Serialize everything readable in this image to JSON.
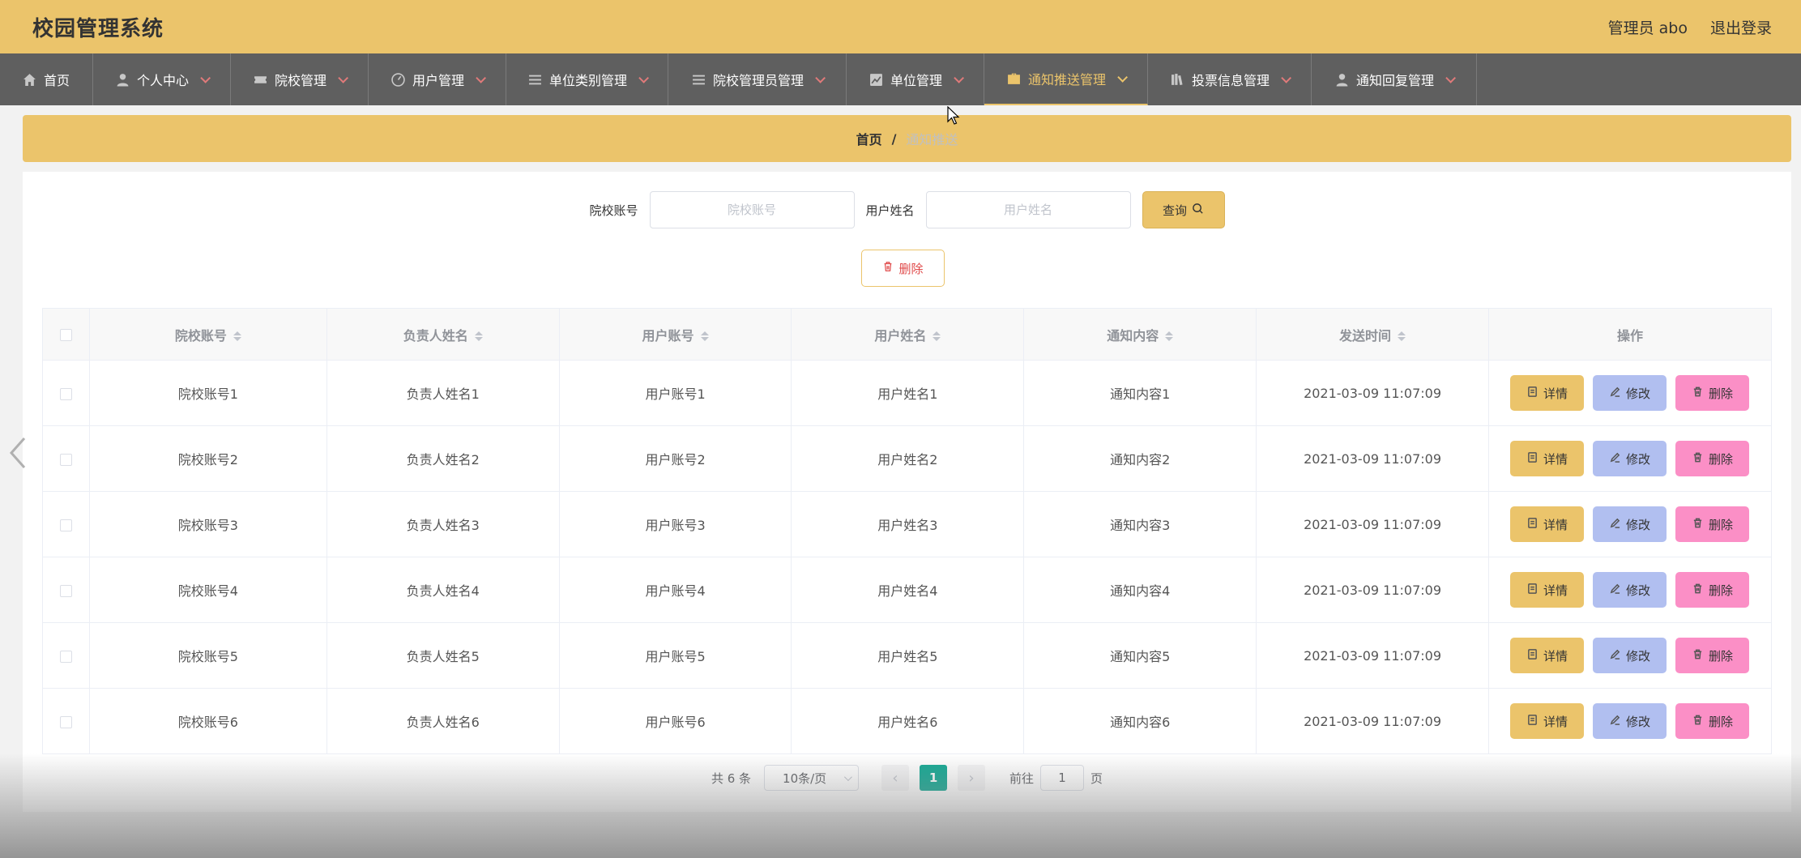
{
  "header": {
    "title": "校园管理系统",
    "user_label": "管理员 abo",
    "logout_label": "退出登录"
  },
  "nav": {
    "items": [
      {
        "label": "首页",
        "icon": "home-icon",
        "has_caret": false
      },
      {
        "label": "个人中心",
        "icon": "user-icon",
        "has_caret": true
      },
      {
        "label": "院校管理",
        "icon": "ticket-icon",
        "has_caret": true
      },
      {
        "label": "用户管理",
        "icon": "gauge-icon",
        "has_caret": true
      },
      {
        "label": "单位类别管理",
        "icon": "list-icon",
        "has_caret": true
      },
      {
        "label": "院校管理员管理",
        "icon": "list-icon",
        "has_caret": true
      },
      {
        "label": "单位管理",
        "icon": "chart-icon",
        "has_caret": true
      },
      {
        "label": "通知推送管理",
        "icon": "briefcase-icon",
        "has_caret": true,
        "active": true
      },
      {
        "label": "投票信息管理",
        "icon": "books-icon",
        "has_caret": true
      },
      {
        "label": "通知回复管理",
        "icon": "user-icon",
        "has_caret": true
      }
    ]
  },
  "breadcrumb": {
    "home": "首页",
    "separator": "/",
    "current": "通知推送"
  },
  "search": {
    "school_label": "院校账号",
    "school_placeholder": "院校账号",
    "school_value": "",
    "user_label": "用户姓名",
    "user_placeholder": "用户姓名",
    "user_value": "",
    "query_label": "查询"
  },
  "toolbar": {
    "delete_label": "删除"
  },
  "table": {
    "columns": [
      "院校账号",
      "负责人姓名",
      "用户账号",
      "用户姓名",
      "通知内容",
      "发送时间",
      "操作"
    ],
    "rows": [
      [
        "院校账号1",
        "负责人姓名1",
        "用户账号1",
        "用户姓名1",
        "通知内容1",
        "2021-03-09 11:07:09"
      ],
      [
        "院校账号2",
        "负责人姓名2",
        "用户账号2",
        "用户姓名2",
        "通知内容2",
        "2021-03-09 11:07:09"
      ],
      [
        "院校账号3",
        "负责人姓名3",
        "用户账号3",
        "用户姓名3",
        "通知内容3",
        "2021-03-09 11:07:09"
      ],
      [
        "院校账号4",
        "负责人姓名4",
        "用户账号4",
        "用户姓名4",
        "通知内容4",
        "2021-03-09 11:07:09"
      ],
      [
        "院校账号5",
        "负责人姓名5",
        "用户账号5",
        "用户姓名5",
        "通知内容5",
        "2021-03-09 11:07:09"
      ],
      [
        "院校账号6",
        "负责人姓名6",
        "用户账号6",
        "用户姓名6",
        "通知内容6",
        "2021-03-09 11:07:09"
      ]
    ],
    "actions": {
      "detail": "详情",
      "edit": "修改",
      "delete": "删除"
    }
  },
  "pagination": {
    "total": "共 6 条",
    "page_size": "10条/页",
    "current_page": "1",
    "goto_prefix": "前往",
    "goto_value": "1",
    "goto_suffix": "页"
  },
  "colors": {
    "accent": "#ebc46b",
    "nav_bg": "#5f5f5f",
    "edit_btn": "#b1bff0",
    "delete_btn": "#fb8fc6",
    "page_active": "#13a893"
  }
}
